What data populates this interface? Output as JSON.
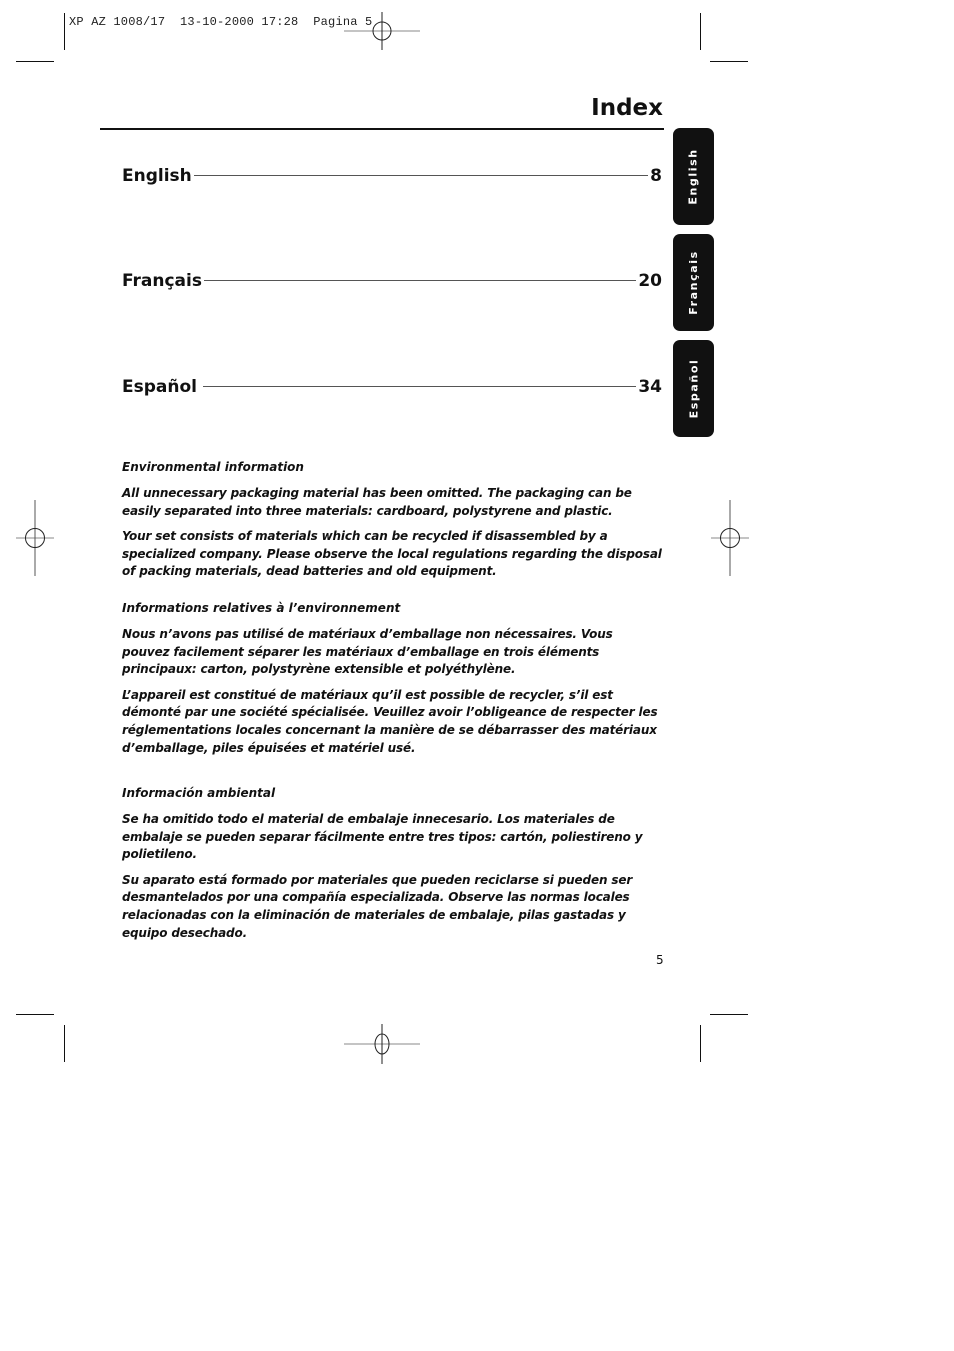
{
  "print_slug": "XP AZ 1008/17  13-10-2000 17:28  Pagina 5",
  "header": {
    "title": "Index"
  },
  "toc": [
    {
      "label": "English",
      "page": "8"
    },
    {
      "label": "Français",
      "page": "20"
    },
    {
      "label": "Español",
      "page": "34"
    }
  ],
  "side_tabs": [
    {
      "label": "English"
    },
    {
      "label": "Français"
    },
    {
      "label": "Español"
    }
  ],
  "environmental_sections": [
    {
      "heading": "Environmental information",
      "paragraphs": [
        "All unnecessary packaging material has been omitted. The packaging can be easily separated into three materials: cardboard, polystyrene and plastic.",
        "Your set consists of materials which can be recycled if disassembled by a specialized company. Please observe the local regulations regarding the disposal of packing materials, dead batteries and old equipment."
      ]
    },
    {
      "heading": "Informations relatives à l’environnement",
      "paragraphs": [
        "Nous n’avons pas utilisé de matériaux d’emballage non nécessaires. Vous pouvez facilement séparer les matériaux d’emballage en trois éléments principaux: carton, polystyrène extensible et polyéthylène.",
        "L’appareil est constitué de matériaux qu’il est possible de recycler, s’il est démonté par une société spécialisée. Veuillez avoir l’obligeance de respecter les réglementations locales concernant la manière de se débarrasser des matériaux d’emballage, piles épuisées et matériel usé."
      ]
    },
    {
      "heading": "Información ambiental",
      "paragraphs": [
        "Se ha omitido todo el material de embalaje innecesario. Los materiales de embalaje se pueden separar fácilmente entre tres tipos:  cartón, poliestireno y polietileno.",
        "Su aparato está formado por materiales que pueden reciclarse si pueden ser desmantelados por una compañía especializada. Observe las normas locales relacionadas con la eliminación de materiales de embalaje, pilas gastadas y equipo desechado."
      ]
    }
  ],
  "footer": {
    "page_number": "5"
  }
}
